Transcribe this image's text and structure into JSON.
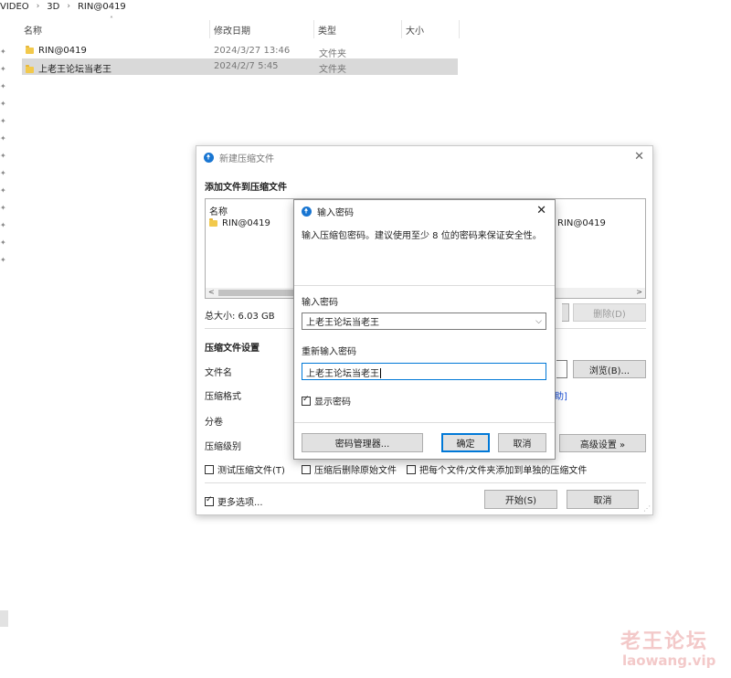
{
  "explorer": {
    "breadcrumb": [
      "VIDEO",
      "3D",
      "RIN@0419"
    ],
    "columns": {
      "name": "名称",
      "modified": "修改日期",
      "type": "类型",
      "size": "大小"
    },
    "rows": [
      {
        "name": "RIN@0419",
        "modified": "2024/3/27 13:46",
        "type": "文件夹"
      },
      {
        "name": "上老王论坛当老王",
        "modified": "2024/2/7 5:45",
        "type": "文件夹"
      }
    ]
  },
  "archive_dialog": {
    "title": "新建压缩文件",
    "section_add": "添加文件到压缩文件",
    "list_header": "名称",
    "list_items": [
      "RIN@0419"
    ],
    "list_items_right": [
      "RIN@0419"
    ],
    "total_size": "总大小: 6.03 GB",
    "delete_label": "删除(D)",
    "section_settings": "压缩文件设置",
    "label_filename": "文件名",
    "browse_label": "浏览(B)...",
    "label_format": "压缩格式",
    "format_link_tail": "助]",
    "label_volume": "分卷",
    "label_level": "压缩级别",
    "advanced_label": "高级设置 »",
    "check_test": "测试压缩文件(T)",
    "check_delete_src": "压缩后删除原始文件",
    "check_each_separate": "把每个文件/文件夹添加到单独的压缩文件",
    "check_more": "更多选项...",
    "start_label": "开始(S)",
    "cancel_label": "取消"
  },
  "password_dialog": {
    "title": "输入密码",
    "hint": "输入压缩包密码。建议使用至少 8 位的密码来保证安全性。",
    "label_pw": "输入密码",
    "pw_value": "上老王论坛当老王",
    "label_repeat": "重新输入密码",
    "repeat_value": "上老王论坛当老王",
    "show_password": "显示密码",
    "manager_label": "密码管理器...",
    "ok_label": "确定",
    "cancel_label": "取消"
  },
  "watermark": {
    "cn": "老王论坛",
    "url": "laowang.vip"
  },
  "colors": {
    "accent": "#0078d7",
    "app_icon": "#1976d2",
    "watermark": "#f3c9c9",
    "selection": "#d9d9d9"
  }
}
